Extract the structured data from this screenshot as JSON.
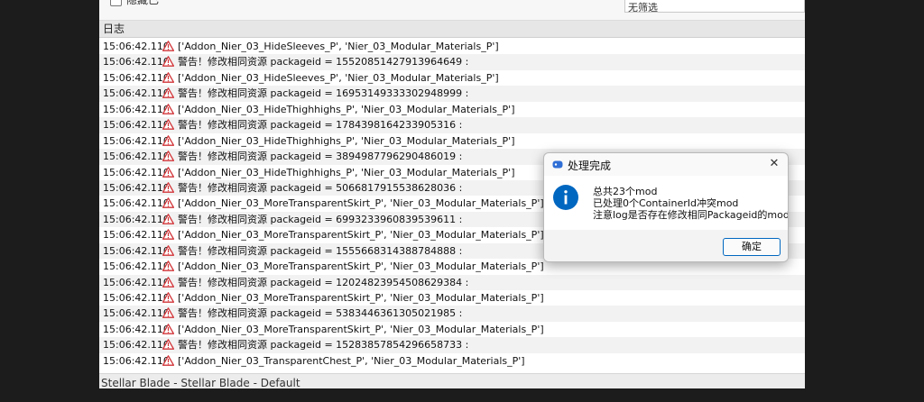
{
  "toolbar": {
    "checkbox_label": "隐藏已",
    "search_value": "无筛选"
  },
  "log": {
    "header": "日志",
    "rows": [
      {
        "time": "15:06:42.110",
        "message": "['Addon_Nier_03_HideSleeves_P', 'Nier_03_Modular_Materials_P']"
      },
      {
        "time": "15:06:42.110",
        "message": "警告！修改相同资源 packageid = 15520851427913964649 :"
      },
      {
        "time": "15:06:42.110",
        "message": "['Addon_Nier_03_HideSleeves_P', 'Nier_03_Modular_Materials_P']"
      },
      {
        "time": "15:06:42.110",
        "message": "警告！修改相同资源 packageid = 16953149333302948999 :"
      },
      {
        "time": "15:06:42.110",
        "message": "['Addon_Nier_03_HideThighhighs_P', 'Nier_03_Modular_Materials_P']"
      },
      {
        "time": "15:06:42.110",
        "message": "警告！修改相同资源 packageid = 1784398164233905316 :"
      },
      {
        "time": "15:06:42.110",
        "message": "['Addon_Nier_03_HideThighhighs_P', 'Nier_03_Modular_Materials_P']"
      },
      {
        "time": "15:06:42.110",
        "message": "警告！修改相同资源 packageid = 3894987796290486019 :"
      },
      {
        "time": "15:06:42.110",
        "message": "['Addon_Nier_03_HideThighhighs_P', 'Nier_03_Modular_Materials_P']"
      },
      {
        "time": "15:06:42.110",
        "message": "警告！修改相同资源 packageid = 5066817915538628036 :"
      },
      {
        "time": "15:06:42.110",
        "message": "['Addon_Nier_03_MoreTransparentSkirt_P', 'Nier_03_Modular_Materials_P']"
      },
      {
        "time": "15:06:42.110",
        "message": "警告！修改相同资源 packageid = 6993233960839539611 :"
      },
      {
        "time": "15:06:42.110",
        "message": "['Addon_Nier_03_MoreTransparentSkirt_P', 'Nier_03_Modular_Materials_P']"
      },
      {
        "time": "15:06:42.110",
        "message": "警告！修改相同资源 packageid = 1555668314388784888 :"
      },
      {
        "time": "15:06:42.110",
        "message": "['Addon_Nier_03_MoreTransparentSkirt_P', 'Nier_03_Modular_Materials_P']"
      },
      {
        "time": "15:06:42.110",
        "message": "警告！修改相同资源 packageid = 12024823954508629384 :"
      },
      {
        "time": "15:06:42.110",
        "message": "['Addon_Nier_03_MoreTransparentSkirt_P', 'Nier_03_Modular_Materials_P']"
      },
      {
        "time": "15:06:42.110",
        "message": "警告！修改相同资源 packageid = 5383446361305021985 :"
      },
      {
        "time": "15:06:42.110",
        "message": "['Addon_Nier_03_MoreTransparentSkirt_P', 'Nier_03_Modular_Materials_P']"
      },
      {
        "time": "15:06:42.110",
        "message": "警告！修改相同资源 packageid = 15283857854296658733 :"
      },
      {
        "time": "15:06:42.110",
        "message": "['Addon_Nier_03_TransparentChest_P', 'Nier_03_Modular_Materials_P']"
      }
    ]
  },
  "status_bar": {
    "text": "Stellar Blade - Stellar Blade - Default"
  },
  "dialog": {
    "title": "处理完成",
    "lines": [
      "总共23个mod",
      "已处理0个ContainerId冲突mod",
      "注意log是否存在修改相同Packageid的mod"
    ],
    "ok_label": "确定"
  },
  "colors": {
    "warning": "#d13438",
    "info": "#0067c0",
    "accent": "#0067c0"
  },
  "icons": {
    "row_icon": "warning-triangle-icon",
    "dialog_icon": "info-icon",
    "close": "close-icon"
  }
}
